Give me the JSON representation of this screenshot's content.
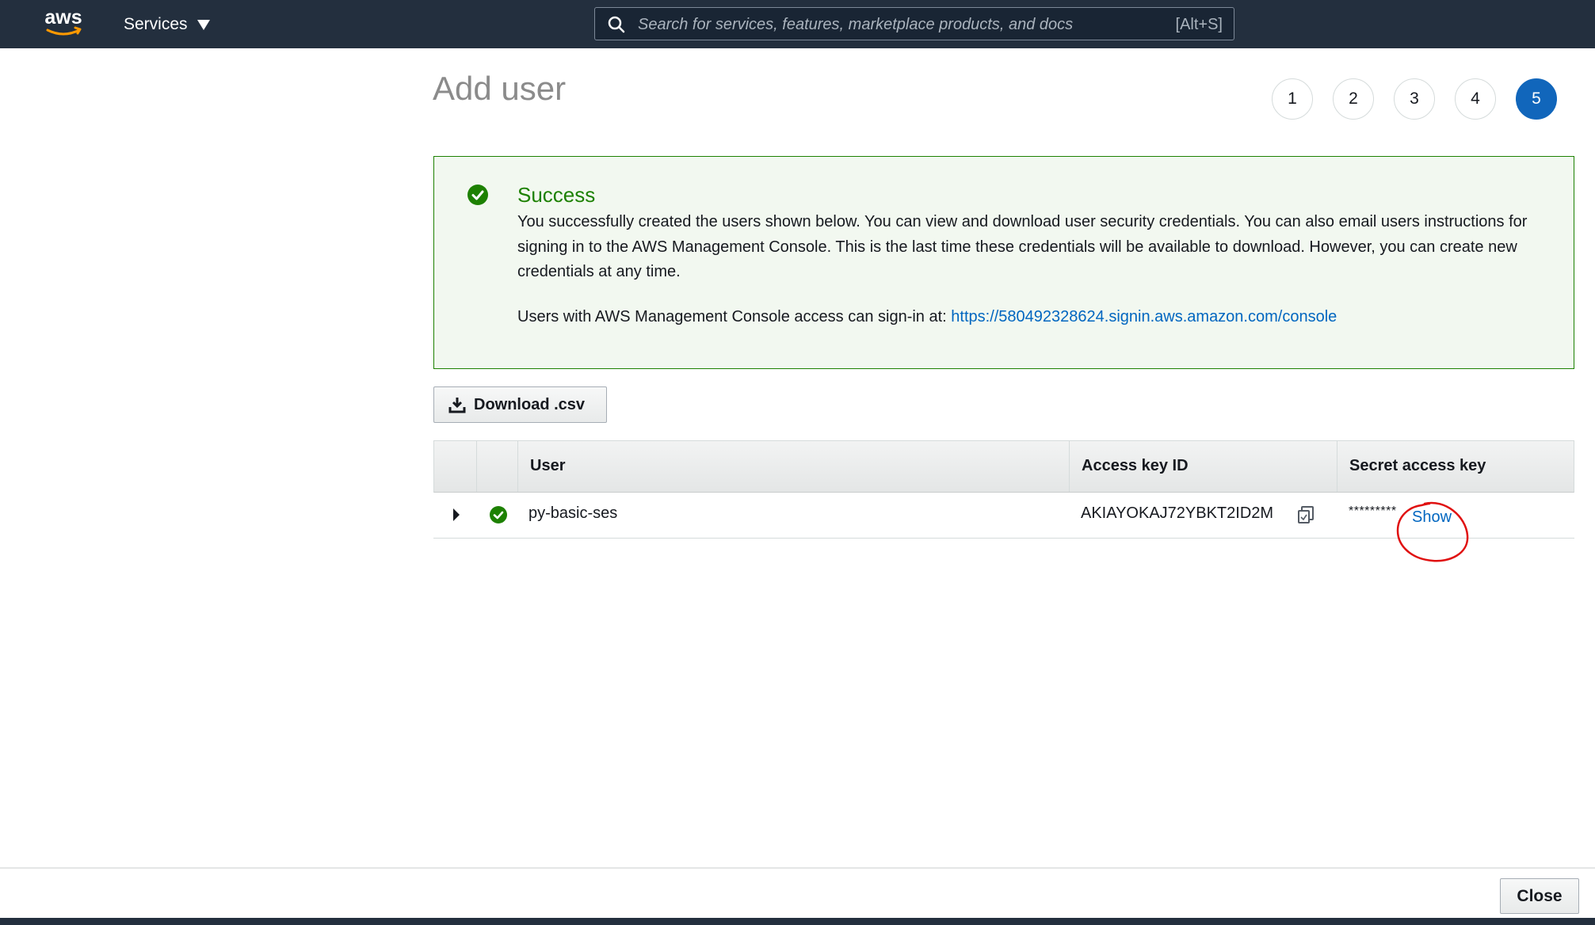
{
  "nav": {
    "logo_text": "aws",
    "services_label": "Services",
    "search_placeholder": "Search for services, features, marketplace products, and docs",
    "search_shortcut": "[Alt+S]"
  },
  "page": {
    "title": "Add user",
    "steps": [
      "1",
      "2",
      "3",
      "4",
      "5"
    ],
    "active_step": "5"
  },
  "alert": {
    "title": "Success",
    "body": "You successfully created the users shown below. You can view and download user security credentials. You can also email users instructions for signing in to the AWS Management Console. This is the last time these credentials will be available to download. However, you can create new credentials at any time.",
    "signin_prefix": "Users with AWS Management Console access can sign-in at: ",
    "signin_url": "https://580492328624.signin.aws.amazon.com/console"
  },
  "download_label": "Download .csv",
  "table": {
    "columns": [
      "User",
      "Access key ID",
      "Secret access key"
    ],
    "rows": [
      {
        "user": "py-basic-ses",
        "access_key_id": "AKIAYOKAJ72YBKT2ID2M",
        "secret_masked": "*********",
        "show_label": "Show"
      }
    ]
  },
  "footer": {
    "close_label": "Close"
  },
  "colors": {
    "nav_bg": "#232f3e",
    "success_green": "#1d8102",
    "link_blue": "#0066c0",
    "active_step": "#1166bb",
    "annotation_red": "#e01010"
  }
}
